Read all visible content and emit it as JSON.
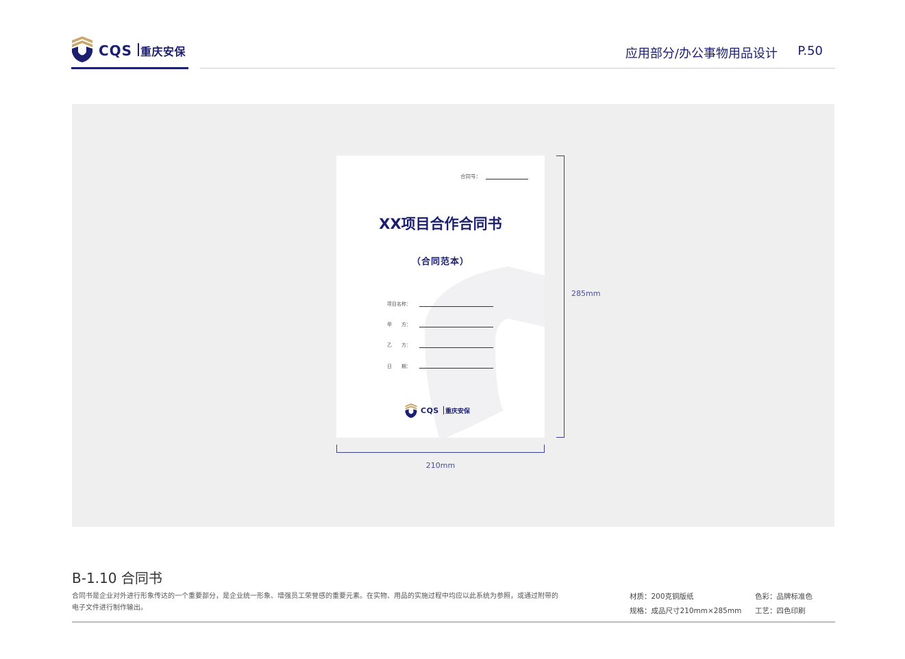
{
  "brand": {
    "mark": "CQS",
    "name_cn": "重庆安保",
    "colors": {
      "primary": "#1c1f6e",
      "accent": "#c9a96e",
      "panel": "#efefef"
    }
  },
  "header": {
    "section": "应用部分/办公事物用品设计",
    "page": "P.50"
  },
  "document": {
    "contract_no_label": "合同号：",
    "title": "XX项目合作合同书",
    "subtitle": "（合同范本）",
    "fields": [
      {
        "label": "项目名称："
      },
      {
        "label": "甲　　方："
      },
      {
        "label": "乙　　方："
      },
      {
        "label": "日　　期："
      }
    ]
  },
  "dimensions": {
    "height": "285mm",
    "width": "210mm"
  },
  "section": {
    "title": "B-1.10 合同书",
    "description": "合同书是企业对外进行形象传达的一个重要部分，是企业统一形象、增强员工荣誉感的重要元素。在实物、用品的实施过程中均应以此系统为参照，或通过附带的电子文件进行制作输出。"
  },
  "specs": {
    "material": "材质：200克铜版纸",
    "size": "规格：成品尺寸210mm×285mm",
    "color": "色彩：品牌标准色",
    "process": "工艺：四色印刷"
  }
}
